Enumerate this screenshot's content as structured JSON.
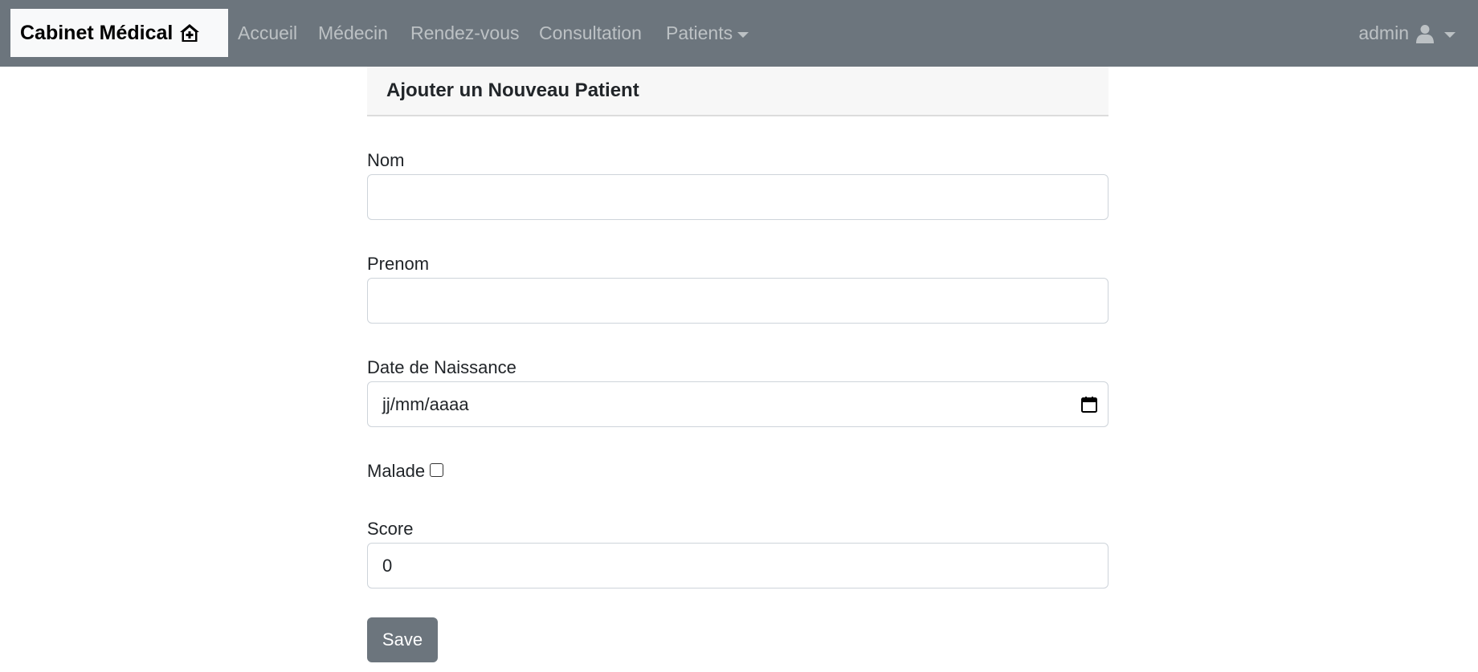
{
  "navbar": {
    "brand": "Cabinet Médical",
    "brand_icon": "house-medical-icon",
    "links": [
      {
        "label": "Accueil"
      },
      {
        "label": "Médecin"
      },
      {
        "label": "Rendez-vous"
      },
      {
        "label": "Consultation"
      },
      {
        "label": "Patients"
      }
    ],
    "user": {
      "name": "admin",
      "icon": "user-icon"
    }
  },
  "form": {
    "title": "Ajouter un Nouveau Patient",
    "fields": {
      "nom": {
        "label": "Nom",
        "value": ""
      },
      "prenom": {
        "label": "Prenom",
        "value": ""
      },
      "date_naissance": {
        "label": "Date de Naissance",
        "placeholder": "jj/mm/aaaa"
      },
      "malade": {
        "label": "Malade",
        "checked": false
      },
      "score": {
        "label": "Score",
        "value": "0"
      }
    },
    "save_label": "Save"
  },
  "colors": {
    "navbar_bg": "#6c757d",
    "brand_bg": "#f8f9fa",
    "button_bg": "#6c757d",
    "card_header_bg": "#f7f7f7"
  }
}
